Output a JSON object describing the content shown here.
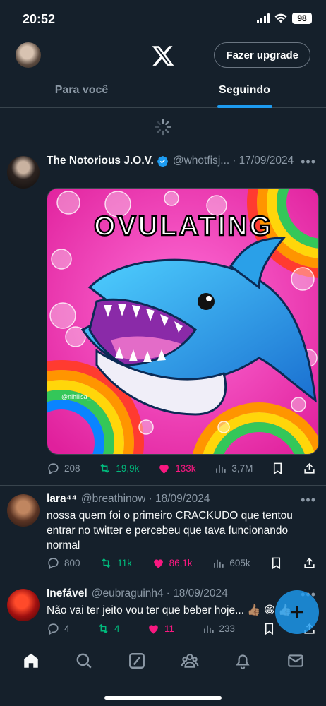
{
  "status": {
    "time": "20:52",
    "battery": "98"
  },
  "header": {
    "upgrade_label": "Fazer upgrade",
    "logo": "x-logo"
  },
  "tabs": [
    {
      "label": "Para você",
      "active": false
    },
    {
      "label": "Seguindo",
      "active": true
    }
  ],
  "tweets": [
    {
      "name": "The Notorious J.O.V.",
      "verified": true,
      "handle": "@whotfisj...",
      "date": "· 17/09/2024",
      "text": "",
      "media": {
        "title": "OVULATING",
        "watermark": "@nihilisa_"
      },
      "replies": "208",
      "retweets": "19,9k",
      "likes": "133k",
      "views": "3,7M"
    },
    {
      "name": "lara⁴⁴",
      "verified": false,
      "handle": "@breathinow",
      "date": "· 18/09/2024",
      "text": "nossa quem foi o primeiro CRACKUDO que tentou entrar no twitter e percebeu que tava funcionando normal",
      "replies": "800",
      "retweets": "11k",
      "likes": "86,1k",
      "views": "605k"
    },
    {
      "name": "Inefável",
      "verified": false,
      "handle": "@eubraguinh4",
      "date": "· 18/09/2024",
      "text": "Não vai ter jeito vou ter que beber hoje... 👍🏽 😁 👍🏻",
      "replies": "4",
      "retweets": "4",
      "likes": "11",
      "views": "233"
    }
  ],
  "colors": {
    "background": "#15202b",
    "accent": "#1d9bf0",
    "retweet": "#00ba7c",
    "like": "#f91880",
    "muted": "#8b98a5"
  },
  "nav": [
    "home-icon",
    "search-icon",
    "grok-icon",
    "communities-icon",
    "notifications-icon",
    "messages-icon"
  ]
}
